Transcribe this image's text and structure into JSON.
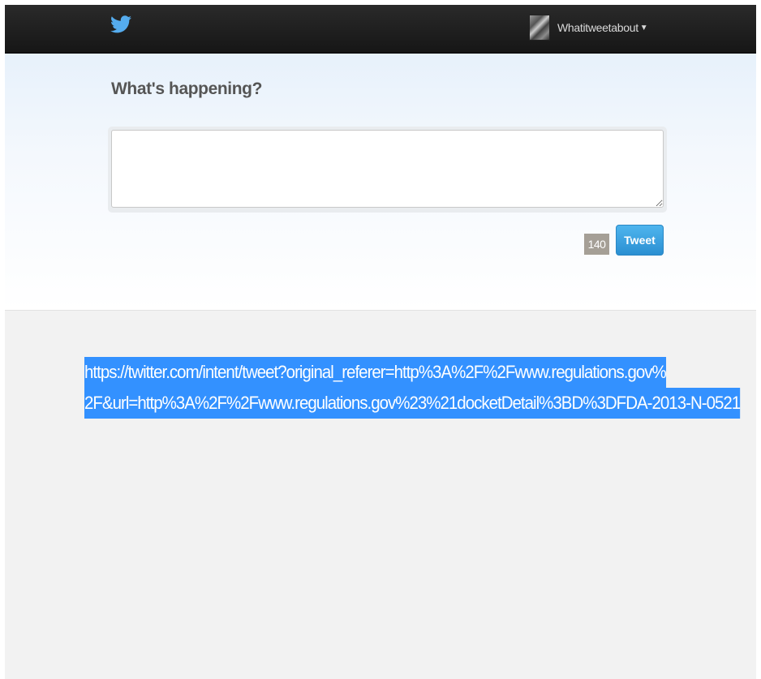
{
  "header": {
    "logo_icon": "twitter-bird-icon",
    "user_menu": {
      "username": "Whatitweetabout",
      "caret_icon": "caret-down-icon"
    }
  },
  "composer": {
    "title": "What's happening?",
    "textarea": {
      "value": "",
      "placeholder": ""
    },
    "char_count": "140",
    "tweet_button_label": "Tweet"
  },
  "selected_text": {
    "line1": "https://twitter.com/intent/tweet?original_referer=http%3A%2F%2Fwww.regulations.gov%",
    "line2": "2F&url=http%3A%2F%2Fwww.regulations.gov%23%21docketDetail%3BD%3DFDA-2013-N-0521"
  },
  "colors": {
    "brand_blue": "#55acee",
    "header_bg": "#1b1b1b",
    "selection": "#3391ff",
    "counter_bg": "#a59f96"
  }
}
